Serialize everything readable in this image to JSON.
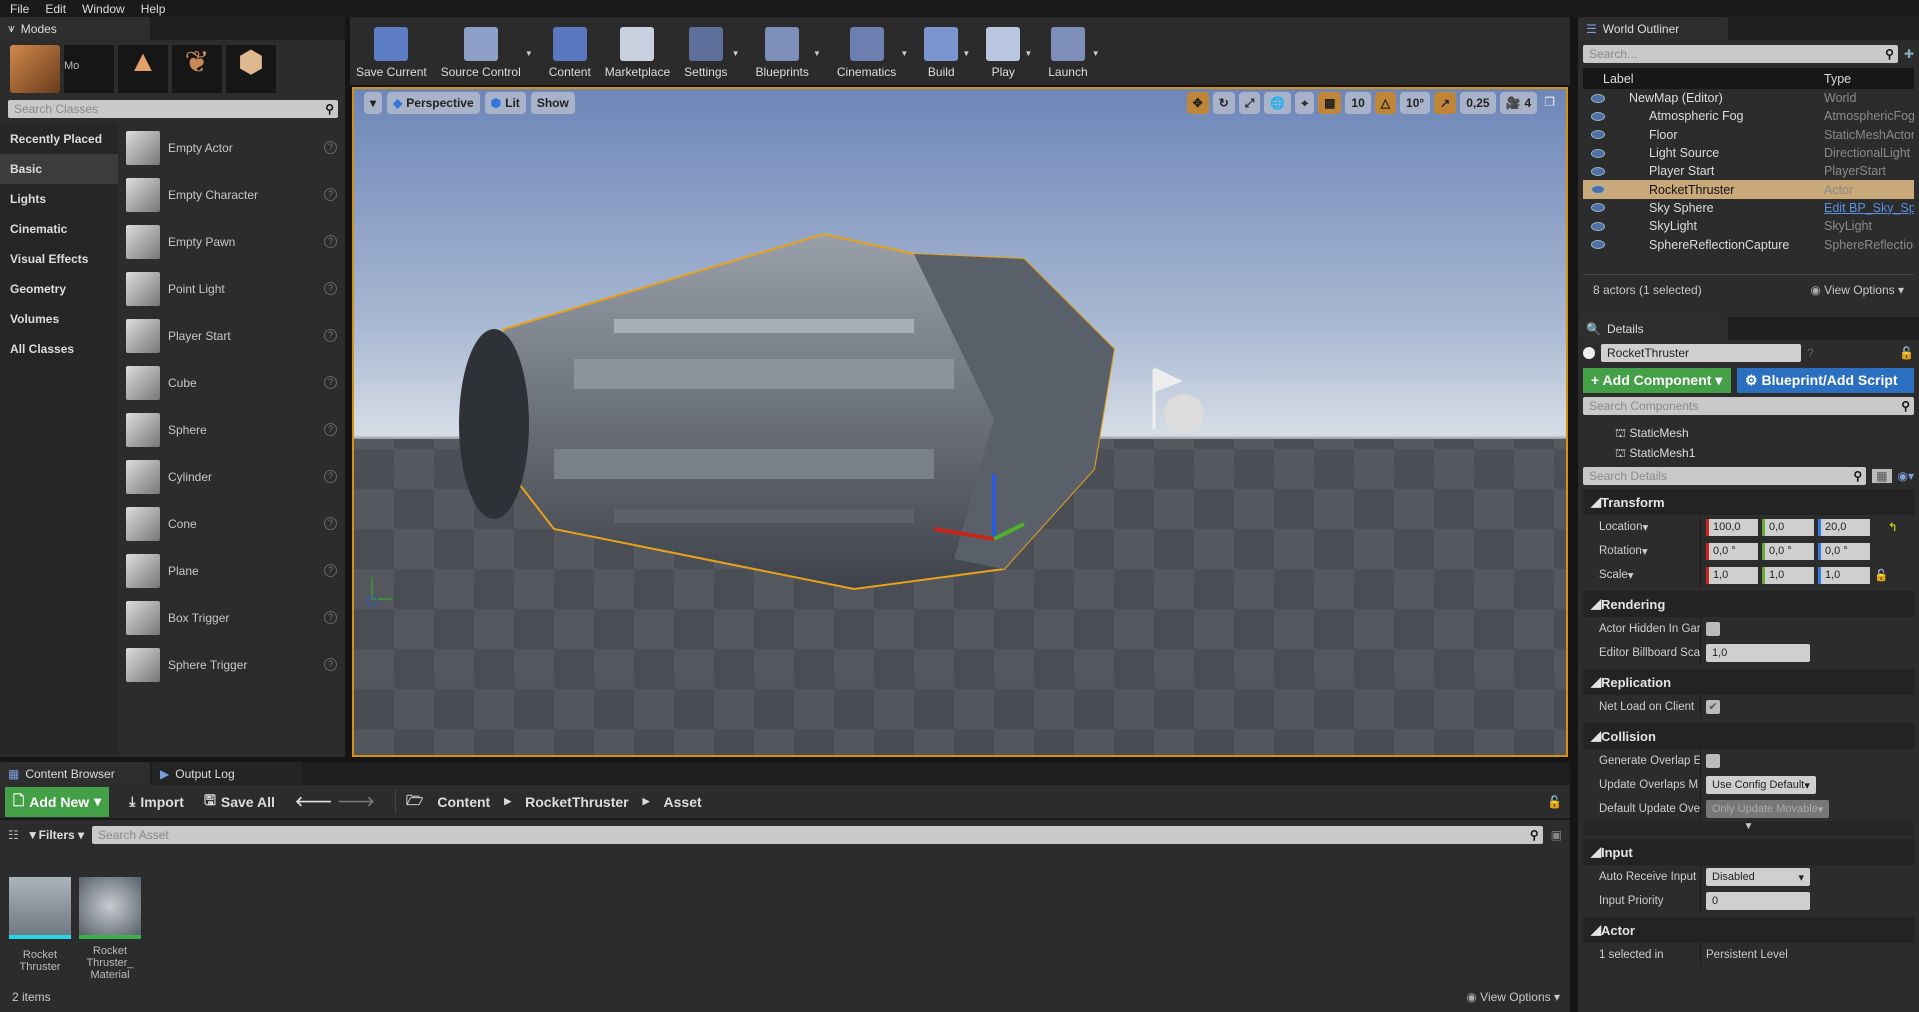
{
  "menu": [
    "File",
    "Edit",
    "Window",
    "Help"
  ],
  "modes": {
    "tab": "Modes",
    "tooltip": "Mo",
    "search_placeholder": "Search Classes",
    "categories": [
      "Recently Placed",
      "Basic",
      "Lights",
      "Cinematic",
      "Visual Effects",
      "Geometry",
      "Volumes",
      "All Classes"
    ],
    "selected_category": "Basic",
    "items": [
      "Empty Actor",
      "Empty Character",
      "Empty Pawn",
      "Point Light",
      "Player Start",
      "Cube",
      "Sphere",
      "Cylinder",
      "Cone",
      "Plane",
      "Box Trigger",
      "Sphere Trigger"
    ]
  },
  "toolbar": [
    {
      "label": "Save Current",
      "color": "#5c7cc4"
    },
    {
      "label": "Source Control",
      "color": "#8ea0c8",
      "dropdown": true
    },
    {
      "label": "Content",
      "color": "#5a77c0"
    },
    {
      "label": "Marketplace",
      "color": "#c8d0e0"
    },
    {
      "label": "Settings",
      "color": "#5d6f9a",
      "dropdown": true
    },
    {
      "label": "Blueprints",
      "color": "#7d8fb8",
      "dropdown": true
    },
    {
      "label": "Cinematics",
      "color": "#6b7fb0",
      "dropdown": true
    },
    {
      "label": "Build",
      "color": "#7a95d0",
      "dropdown": true
    },
    {
      "label": "Play",
      "color": "#b9c6e0",
      "dropdown": true
    },
    {
      "label": "Launch",
      "color": "#7d8fb8",
      "dropdown": true
    }
  ],
  "viewport": {
    "view_mode": "Perspective",
    "lighting": "Lit",
    "show": "Show",
    "grid_snap": "10",
    "rotation_snap": "10°",
    "scale_snap": "0,25",
    "camera_speed": "4"
  },
  "outliner": {
    "tab": "World Outliner",
    "search_placeholder": "Search...",
    "col_label": "Label",
    "col_type": "Type",
    "rows": [
      {
        "label": "NewMap (Editor)",
        "type": "World"
      },
      {
        "label": "Atmospheric Fog",
        "type": "AtmosphericFog"
      },
      {
        "label": "Floor",
        "type": "StaticMeshActor"
      },
      {
        "label": "Light Source",
        "type": "DirectionalLight"
      },
      {
        "label": "Player Start",
        "type": "PlayerStart"
      },
      {
        "label": "RocketThruster",
        "type": "Actor",
        "selected": true
      },
      {
        "label": "Sky Sphere",
        "type": "Edit BP_Sky_Sp"
      },
      {
        "label": "SkyLight",
        "type": "SkyLight"
      },
      {
        "label": "SphereReflectionCapture",
        "type": "SphereReflection"
      }
    ],
    "status": "8 actors (1 selected)",
    "view_options": "View Options"
  },
  "details": {
    "tab": "Details",
    "actor_name": "RocketThruster",
    "add_component": "+ Add Component",
    "blueprint": "Blueprint/Add Script",
    "search_components": "Search Components",
    "components": [
      "StaticMesh",
      "StaticMesh1"
    ],
    "search_details": "Search Details",
    "transform": {
      "title": "Transform",
      "location_label": "Location",
      "location": [
        "100,0",
        "0,0",
        "20,0"
      ],
      "rotation_label": "Rotation",
      "rotation": [
        "0,0 °",
        "0,0 °",
        "0,0 °"
      ],
      "scale_label": "Scale",
      "scale": [
        "1,0",
        "1,0",
        "1,0"
      ]
    },
    "rendering": {
      "title": "Rendering",
      "hidden_label": "Actor Hidden In Gar",
      "hidden": false,
      "billboard_label": "Editor Billboard Sca",
      "billboard": "1,0"
    },
    "replication": {
      "title": "Replication",
      "net_load_label": "Net Load on Client",
      "net_load": true
    },
    "collision": {
      "title": "Collision",
      "gen_overlap_label": "Generate Overlap E",
      "gen_overlap": false,
      "update_overlaps_label": "Update Overlaps M",
      "update_overlaps": "Use Config Default",
      "default_update_label": "Default Update Ove",
      "default_update": "Only Update Movable"
    },
    "input": {
      "title": "Input",
      "auto_receive_label": "Auto Receive Input",
      "auto_receive": "Disabled",
      "priority_label": "Input Priority",
      "priority": "0"
    },
    "actor": {
      "title": "Actor",
      "selected_in_label": "1 selected in",
      "selected_in": "Persistent Level"
    }
  },
  "content_browser": {
    "tab": "Content Browser",
    "output_tab": "Output Log",
    "add_new": "Add New",
    "import": "Import",
    "save_all": "Save All",
    "path": [
      "Content",
      "RocketThruster",
      "Asset"
    ],
    "filters": "Filters",
    "search_placeholder": "Search Asset",
    "assets": [
      {
        "name": "Rocket Thruster",
        "color": "#22d8e8"
      },
      {
        "name": "Rocket Thruster_ Material",
        "color": "#3bb34a"
      }
    ],
    "count": "2 items",
    "view_options": "View Options"
  }
}
